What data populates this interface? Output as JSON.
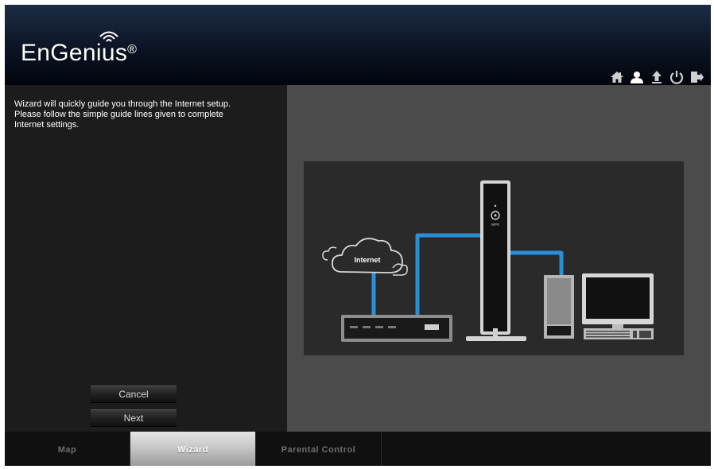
{
  "brand": {
    "name": "EnGenius",
    "registered": "®"
  },
  "toolbar": {
    "icons": [
      "home-icon",
      "user-icon",
      "upload-icon",
      "power-icon",
      "logout-icon"
    ]
  },
  "wizard": {
    "intro_lines": [
      "Wizard will quickly guide you through the Internet setup.",
      "Please follow the simple guide lines given to complete",
      "Internet settings."
    ],
    "cancel_label": "Cancel",
    "next_label": "Next"
  },
  "diagram": {
    "cloud_label": "Internet",
    "device_label": "WPS"
  },
  "tabs": [
    {
      "label": "Map",
      "active": false
    },
    {
      "label": "Wizard",
      "active": true
    },
    {
      "label": "Parental Control",
      "active": false
    }
  ],
  "colors": {
    "cable": "#2b8fd6",
    "header_dark": "#02050b",
    "active_tab": "#c7c7c7"
  }
}
